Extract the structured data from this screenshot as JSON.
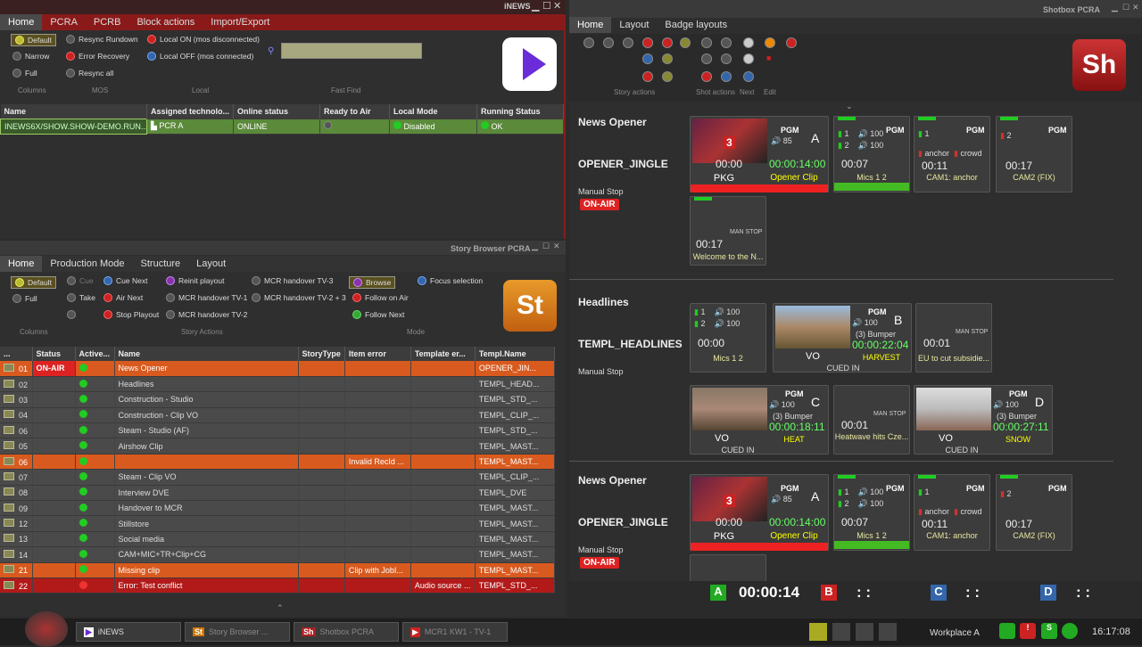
{
  "inews": {
    "window_title": "iNEWS",
    "tabs": [
      "Home",
      "PCRA",
      "PCRB",
      "Block actions",
      "Import/Export"
    ],
    "columns_buttons": [
      "Default",
      "Narrow",
      "Full"
    ],
    "mos_buttons": [
      "Resync Rundown",
      "Error Recovery",
      "Resync all"
    ],
    "local_buttons": [
      "Local ON (mos disconnected)",
      "Local OFF (mos connected)"
    ],
    "groups": [
      "Columns",
      "MOS",
      "Local",
      "Fast Find"
    ],
    "table_headers": [
      "Name",
      "Assigned technolo...",
      "Online status",
      "Ready to Air",
      "Local Mode",
      "Running Status"
    ],
    "row": {
      "name": "INEWS6X/SHOW.SHOW-DEMO.RUN...",
      "tech": "PCR A",
      "online": "ONLINE",
      "local": "Disabled",
      "running": "OK"
    }
  },
  "story": {
    "window_title": "Story Browser PCRA",
    "tabs": [
      "Home",
      "Production Mode",
      "Structure",
      "Layout"
    ],
    "columns_buttons": [
      "Default",
      "Full"
    ],
    "story_actions": [
      "Cue",
      "Cue Next",
      "Take",
      "Air Next",
      "Stop Playout",
      "Reinit playout",
      "MCR handover TV-1",
      "MCR handover TV-2",
      "MCR handover TV-3",
      "MCR handover TV-2 + 3"
    ],
    "mode_buttons": [
      "Browse",
      "Focus selection",
      "Follow on Air",
      "Follow Next"
    ],
    "groups": [
      "Columns",
      "Story Actions",
      "Mode"
    ],
    "headers": [
      "...",
      "Status",
      "Active...",
      "Name",
      "StoryType",
      "Item error",
      "Template er...",
      "Templ.Name"
    ],
    "rows": [
      {
        "num": "01",
        "status": "ON-AIR",
        "active": "green",
        "name": "News Opener",
        "item_error": "",
        "template_error": "",
        "templ": "OPENER_JIN...",
        "style": "orange"
      },
      {
        "num": "02",
        "status": "",
        "active": "green",
        "name": "Headlines",
        "item_error": "",
        "template_error": "",
        "templ": "TEMPL_HEAD...",
        "style": "norm"
      },
      {
        "num": "03",
        "status": "",
        "active": "green",
        "name": "Construction - Studio",
        "item_error": "",
        "template_error": "",
        "templ": "TEMPL_STD_...",
        "style": "norm"
      },
      {
        "num": "04",
        "status": "",
        "active": "green",
        "name": "Construction - Clip VO",
        "item_error": "",
        "template_error": "",
        "templ": "TEMPL_CLIP_...",
        "style": "norm"
      },
      {
        "num": "06",
        "status": "",
        "active": "green",
        "name": "Steam - Studio (AF)",
        "item_error": "",
        "template_error": "",
        "templ": "TEMPL_STD_...",
        "style": "norm"
      },
      {
        "num": "05",
        "status": "",
        "active": "green",
        "name": "Airshow Clip",
        "item_error": "",
        "template_error": "",
        "templ": "TEMPL_MAST...",
        "style": "norm"
      },
      {
        "num": "06",
        "status": "",
        "active": "green",
        "name": "",
        "item_error": "Invalid RecId ...",
        "template_error": "",
        "templ": "TEMPL_MAST...",
        "style": "orange"
      },
      {
        "num": "07",
        "status": "",
        "active": "green",
        "name": "Steam - Clip VO",
        "item_error": "",
        "template_error": "",
        "templ": "TEMPL_CLIP_...",
        "style": "norm"
      },
      {
        "num": "08",
        "status": "",
        "active": "green",
        "name": "Interview DVE",
        "item_error": "",
        "template_error": "",
        "templ": "TEMPL_DVE",
        "style": "norm"
      },
      {
        "num": "09",
        "status": "",
        "active": "green",
        "name": "Handover to MCR",
        "item_error": "",
        "template_error": "",
        "templ": "TEMPL_MAST...",
        "style": "norm"
      },
      {
        "num": "12",
        "status": "",
        "active": "green",
        "name": "Stillstore",
        "item_error": "",
        "template_error": "",
        "templ": "TEMPL_MAST...",
        "style": "norm"
      },
      {
        "num": "13",
        "status": "",
        "active": "green",
        "name": "Social media",
        "item_error": "",
        "template_error": "",
        "templ": "TEMPL_MAST...",
        "style": "norm"
      },
      {
        "num": "14",
        "status": "",
        "active": "green",
        "name": "CAM+MIC+TR+Clip+CG",
        "item_error": "",
        "template_error": "",
        "templ": "TEMPL_MAST...",
        "style": "norm"
      },
      {
        "num": "21",
        "status": "",
        "active": "green",
        "name": "Missing clip",
        "item_error": "Clip with JobI...",
        "template_error": "",
        "templ": "TEMPL_MAST...",
        "style": "orange"
      },
      {
        "num": "22",
        "status": "",
        "active": "red",
        "name": "Error: Test conflict",
        "item_error": "",
        "template_error": "Audio source ...",
        "templ": "TEMPL_STD_...",
        "style": "red"
      }
    ]
  },
  "shotbox": {
    "window_title": "Shotbox PCRA",
    "tabs": [
      "Home",
      "Layout",
      "Badge layouts"
    ],
    "groups": [
      "Story actions",
      "Shot actions",
      "Next",
      "Edit"
    ],
    "sections": [
      {
        "title": "News Opener",
        "template": "OPENER_JINGLE",
        "mode": "Manual Stop",
        "onair": "ON-AIR"
      },
      {
        "title": "Headlines",
        "template": "TEMPL_HEADLINES",
        "mode": "Manual Stop",
        "onair": ""
      },
      {
        "title": "News Opener",
        "template": "OPENER_JINGLE",
        "mode": "Manual Stop",
        "onair": "ON-AIR"
      }
    ],
    "opener_cards": [
      {
        "letter": "A",
        "tag": "PGM",
        "vol": "85",
        "clock": "00:00",
        "clock2": "00:00:14:00",
        "label": "PKG",
        "sub": "Opener Clip",
        "badge": "3"
      },
      {
        "tag": "PGM",
        "ch1": "1",
        "ch2": "2",
        "v1": "100",
        "v2": "100",
        "clock": "00:07",
        "label": "Mics 1 2"
      },
      {
        "tag": "PGM",
        "ch1": "1",
        "anchor": "anchor",
        "crowd": "crowd",
        "clock": "00:11",
        "label": "CAM1: anchor"
      },
      {
        "tag": "PGM",
        "ch1": "2",
        "clock": "00:17",
        "label": "CAM2 (FIX)"
      },
      {
        "stop": "MAN STOP",
        "clock": "00:17",
        "label": "Welcome to the N..."
      }
    ],
    "headline_cards": [
      {
        "ch1": "1",
        "ch2": "2",
        "v1": "100",
        "v2": "100",
        "clock": "00:00",
        "label": "Mics 1 2"
      },
      {
        "letter": "B",
        "tag": "PGM",
        "vol": "100",
        "bumper": "(3) Bumper",
        "clock2": "00:00:22:04",
        "type": "VO",
        "label": "HARVEST",
        "cued": "CUED IN"
      },
      {
        "stop": "MAN STOP",
        "clock": "00:01",
        "label": "EU to cut subsidie..."
      },
      {
        "letter": "C",
        "tag": "PGM",
        "vol": "100",
        "bumper": "(3) Bumper",
        "clock2": "00:00:18:11",
        "type": "VO",
        "label": "HEAT",
        "cued": "CUED IN"
      },
      {
        "stop": "MAN STOP",
        "clock": "00:01",
        "label": "Heatwave hits Cze..."
      },
      {
        "letter": "D",
        "tag": "PGM",
        "vol": "100",
        "bumper": "(3) Bumper",
        "clock2": "00:00:27:11",
        "type": "VO",
        "label": "SNOW",
        "cued": "CUED IN"
      }
    ],
    "bottom": {
      "a_time": "00:00:14",
      "b_time": ": :",
      "c_time": ": :",
      "d_time": ": :"
    }
  },
  "taskbar": {
    "items": [
      "iNEWS",
      "Story Browser ...",
      "Shotbox PCRA",
      "MCR1 KW1 - TV-1"
    ],
    "workplace": "Workplace A",
    "time": "16:17:08"
  },
  "colors": {
    "onair": "#dd2222",
    "orange": "#d95a1e",
    "green": "#22cc22",
    "accent": "#b21a1a"
  }
}
